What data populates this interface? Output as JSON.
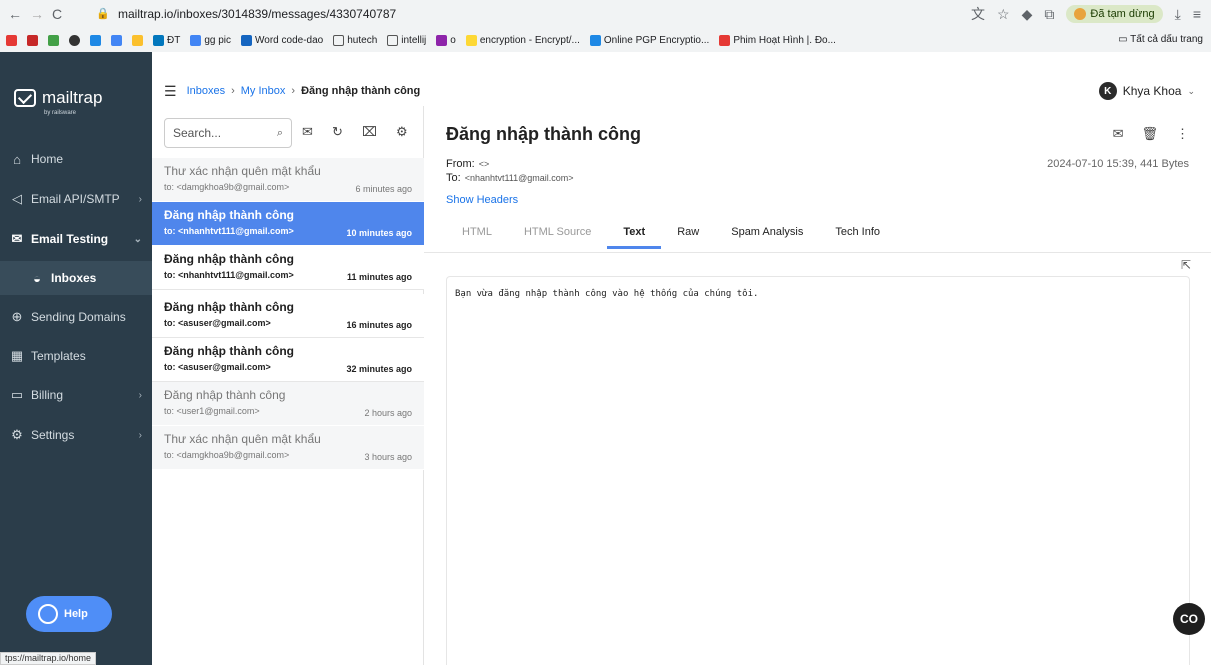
{
  "browser": {
    "url": "mailtrap.io/inboxes/3014839/messages/4330740787",
    "paused_label": "Đã tạm dừng",
    "bookmarks": [
      "ĐT",
      "gg pic",
      "Word code-dao",
      "hutech",
      "intellij",
      "o",
      "encryption - Encrypt/...",
      "Online PGP Encryptio...",
      "Phim Hoạt Hình |. Đo..."
    ],
    "all_bookmarks": "Tất cả dấu trang",
    "status_url": "tps://mailtrap.io/home"
  },
  "sidebar": {
    "logo": "mailtrap",
    "logo_sub": "by railsware",
    "items": [
      {
        "label": "Home",
        "icon": "home-icon"
      },
      {
        "label": "Email API/SMTP",
        "icon": "send-icon"
      },
      {
        "label": "Email Testing",
        "icon": "mail-check-icon"
      },
      {
        "label": "Inboxes",
        "icon": "inbox-icon"
      },
      {
        "label": "Sending Domains",
        "icon": "globe-icon"
      },
      {
        "label": "Templates",
        "icon": "template-icon"
      },
      {
        "label": "Billing",
        "icon": "card-icon"
      },
      {
        "label": "Settings",
        "icon": "gear-icon"
      }
    ],
    "help": "Help"
  },
  "header": {
    "breadcrumb": [
      "Inboxes",
      "My Inbox",
      "Đăng nhập thành công"
    ],
    "user_initial": "K",
    "user_name": "Khya Khoa"
  },
  "list": {
    "search_placeholder": "Search...",
    "messages": [
      {
        "subject": "Thư xác nhận quên mật khẩu",
        "to": "to: <damgkhoa9b@gmail.com>",
        "time": "6 minutes ago"
      },
      {
        "subject": "Đăng nhập thành công",
        "to": "to: <nhanhtvt111@gmail.com>",
        "time": "10 minutes ago"
      },
      {
        "subject": "Đăng nhập thành công",
        "to": "to: <nhanhtvt111@gmail.com>",
        "time": "11 minutes ago"
      },
      {
        "subject": "Đăng nhập thành công",
        "to": "to: <asuser@gmail.com>",
        "time": "16 minutes ago"
      },
      {
        "subject": "Đăng nhập thành công",
        "to": "to: <asuser@gmail.com>",
        "time": "32 minutes ago"
      },
      {
        "subject": "Đăng nhập thành công",
        "to": "to: <user1@gmail.com>",
        "time": "2 hours ago"
      },
      {
        "subject": "Thư xác nhận quên mật khẩu",
        "to": "to: <damgkhoa9b@gmail.com>",
        "time": "3 hours ago"
      }
    ]
  },
  "view": {
    "title": "Đăng nhập thành công",
    "from_label": "From:",
    "from_value": "<>",
    "to_label": "To:",
    "to_value": "<nhanhtvt111@gmail.com>",
    "date": "2024-07-10 15:39, 441 Bytes",
    "show_headers": "Show Headers",
    "tabs": [
      "HTML",
      "HTML Source",
      "Text",
      "Raw",
      "Spam Analysis",
      "Tech Info"
    ],
    "body": "Bạn vừa đăng nhập thành công vào hệ thống của chúng tôi."
  },
  "fab_label": "CO"
}
